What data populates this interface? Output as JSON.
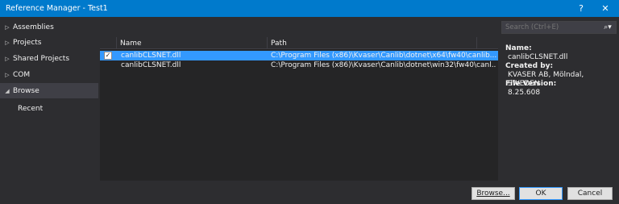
{
  "window": {
    "title": "Reference Manager - Test1",
    "help_glyph": "?",
    "close_glyph": "✕"
  },
  "sidebar": {
    "items": [
      {
        "label": "Assemblies",
        "arrow": "▷"
      },
      {
        "label": "Projects",
        "arrow": "▷"
      },
      {
        "label": "Shared Projects",
        "arrow": "▷"
      },
      {
        "label": "COM",
        "arrow": "▷"
      },
      {
        "label": "Browse",
        "arrow": "◢"
      },
      {
        "label": "Recent",
        "arrow": ""
      }
    ]
  },
  "grid": {
    "columns": [
      "",
      "Name",
      "Path"
    ],
    "rows": [
      {
        "checked": true,
        "check_glyph": "✓",
        "name": "canlibCLSNET.dll",
        "path": "C:\\Program Files (x86)\\Kvaser\\Canlib\\dotnet\\x64\\fw40\\canlib..."
      },
      {
        "checked": false,
        "check_glyph": "",
        "name": "canlibCLSNET.dll",
        "path": "C:\\Program Files (x86)\\Kvaser\\Canlib\\dotnet\\win32\\fw40\\canl..."
      }
    ]
  },
  "search": {
    "placeholder": "Search (Ctrl+E)",
    "icon": "search-icon"
  },
  "details": {
    "name_label": "Name:",
    "name_value": "canlibCLSNET.dll",
    "created_by_label": "Created by:",
    "created_by_value": "KVASER AB, Mölndal, SWEDEN",
    "version_label": "File Version:",
    "version_value": "8.25.608"
  },
  "buttons": {
    "browse": "Browse...",
    "ok": "OK",
    "cancel": "Cancel"
  },
  "colors": {
    "accent": "#007acc",
    "selection": "#3399ff",
    "background": "#2d2d30"
  }
}
